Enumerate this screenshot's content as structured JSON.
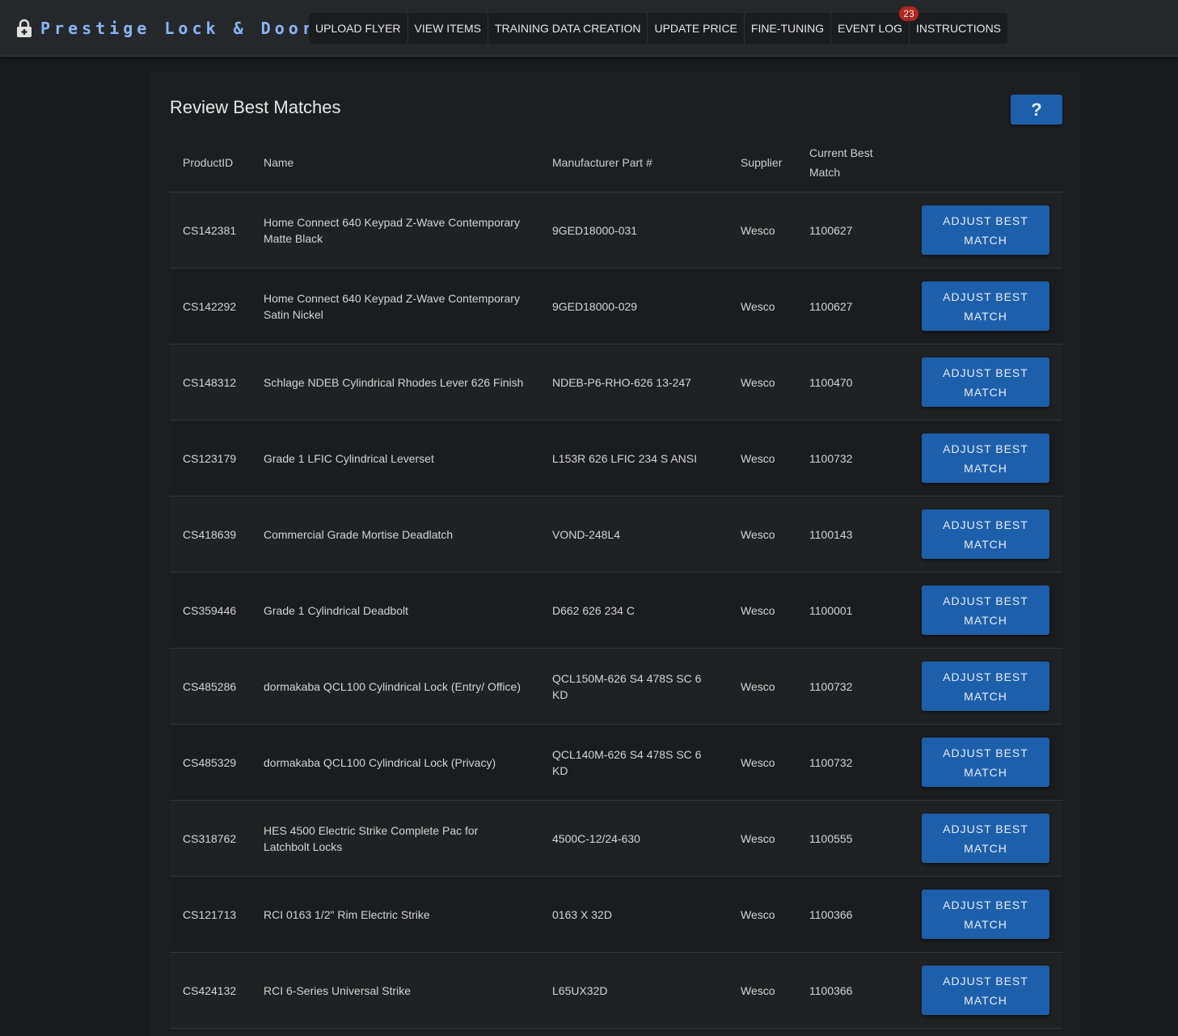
{
  "brand": {
    "name": "Prestige Lock & Door"
  },
  "nav": {
    "items": [
      {
        "label": "UPLOAD FLYER"
      },
      {
        "label": "VIEW ITEMS"
      },
      {
        "label": "TRAINING DATA CREATION"
      },
      {
        "label": "UPDATE PRICE"
      },
      {
        "label": "FINE-TUNING"
      },
      {
        "label": "EVENT LOG",
        "badge": "23"
      },
      {
        "label": "INSTRUCTIONS"
      }
    ]
  },
  "page": {
    "title": "Review Best Matches",
    "help_label": "?"
  },
  "table": {
    "headers": [
      "ProductID",
      "Name",
      "Manufacturer Part #",
      "Supplier",
      "Current Best Match"
    ],
    "action_label": "ADJUST BEST MATCH",
    "rows": [
      {
        "id": "CS142381",
        "name": "Home Connect 640 Keypad Z-Wave Contemporary Matte Black",
        "mpn": "9GED18000-031",
        "supplier": "Wesco",
        "best": "1100627"
      },
      {
        "id": "CS142292",
        "name": "Home Connect 640 Keypad Z-Wave Contemporary Satin Nickel",
        "mpn": "9GED18000-029",
        "supplier": "Wesco",
        "best": "1100627"
      },
      {
        "id": "CS148312",
        "name": "Schlage NDEB Cylindrical Rhodes Lever 626 Finish",
        "mpn": "NDEB-P6-RHO-626 13-247",
        "supplier": "Wesco",
        "best": "1100470"
      },
      {
        "id": "CS123179",
        "name": "Grade 1 LFIC Cylindrical Leverset",
        "mpn": "L153R 626 LFIC 234 S ANSI",
        "supplier": "Wesco",
        "best": "1100732"
      },
      {
        "id": "CS418639",
        "name": "Commercial Grade Mortise Deadlatch",
        "mpn": "VOND-248L4",
        "supplier": "Wesco",
        "best": "1100143"
      },
      {
        "id": "CS359446",
        "name": "Grade 1 Cylindrical Deadbolt",
        "mpn": "D662 626 234 C",
        "supplier": "Wesco",
        "best": "1100001"
      },
      {
        "id": "CS485286",
        "name": "dormakaba QCL100 Cylindrical Lock (Entry/ Office)",
        "mpn": "QCL150M-626 S4 478S SC 6 KD",
        "supplier": "Wesco",
        "best": "1100732"
      },
      {
        "id": "CS485329",
        "name": "dormakaba QCL100 Cylindrical Lock (Privacy)",
        "mpn": "QCL140M-626 S4 478S SC 6 KD",
        "supplier": "Wesco",
        "best": "1100732"
      },
      {
        "id": "CS318762",
        "name": "HES 4500 Electric Strike Complete Pac for Latchbolt Locks",
        "mpn": "4500C-12/24-630",
        "supplier": "Wesco",
        "best": "1100555"
      },
      {
        "id": "CS121713",
        "name": "RCI 0163 1/2\" Rim Electric Strike",
        "mpn": "0163 X 32D",
        "supplier": "Wesco",
        "best": "1100366"
      },
      {
        "id": "CS424132",
        "name": "RCI 6-Series Universal Strike",
        "mpn": "L65UX32D",
        "supplier": "Wesco",
        "best": "1100366"
      }
    ]
  },
  "icons": {
    "brand": "lock-icon"
  },
  "colors": {
    "accent": "#1d5fab",
    "brand_text": "#8ab4f8",
    "badge": "#b3261e"
  }
}
